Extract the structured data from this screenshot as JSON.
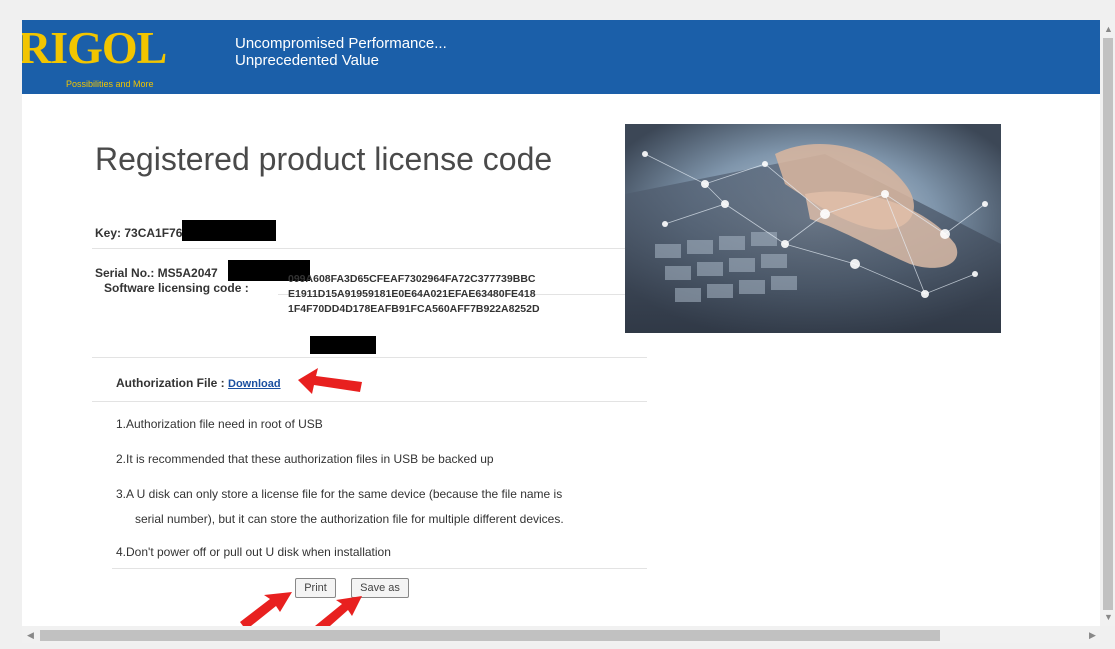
{
  "header": {
    "logo": "RIGOL",
    "logo_tagline": "Possibilities and More",
    "slogan_line1": "Uncompromised Performance...",
    "slogan_line2": "Unprecedented Value"
  },
  "license": {
    "title": "Registered product license code",
    "key_label": "Key: 73CA1F76",
    "serial_label": "Serial No.: MS5A2047",
    "software_label": "Software licensing code :",
    "code_lines": [
      "099A608FA3D65CFEAF7302964FA72C377739BBC",
      "E1911D15A91959181E0E64A021EFAE63480FE418",
      "1F4F70DD4D178EAFB91FCA560AFF7B922A8252D"
    ],
    "auth_label": "Authorization File :",
    "download_link": "Download"
  },
  "notes": [
    "1.Authorization file need in root of USB",
    "2.It is recommended that these authorization files in USB be backed up",
    "3.A U disk can only store a license file for the same device (because the file name is",
    "serial number), but it can store the authorization file for multiple different devices.",
    "4.Don't power off or pull out U disk when installation"
  ],
  "buttons": {
    "print": "Print",
    "save_as": "Save as"
  },
  "colors": {
    "banner": "#1b5fa9",
    "logo": "#f2c500",
    "annotation_arrow": "#e8201f"
  }
}
